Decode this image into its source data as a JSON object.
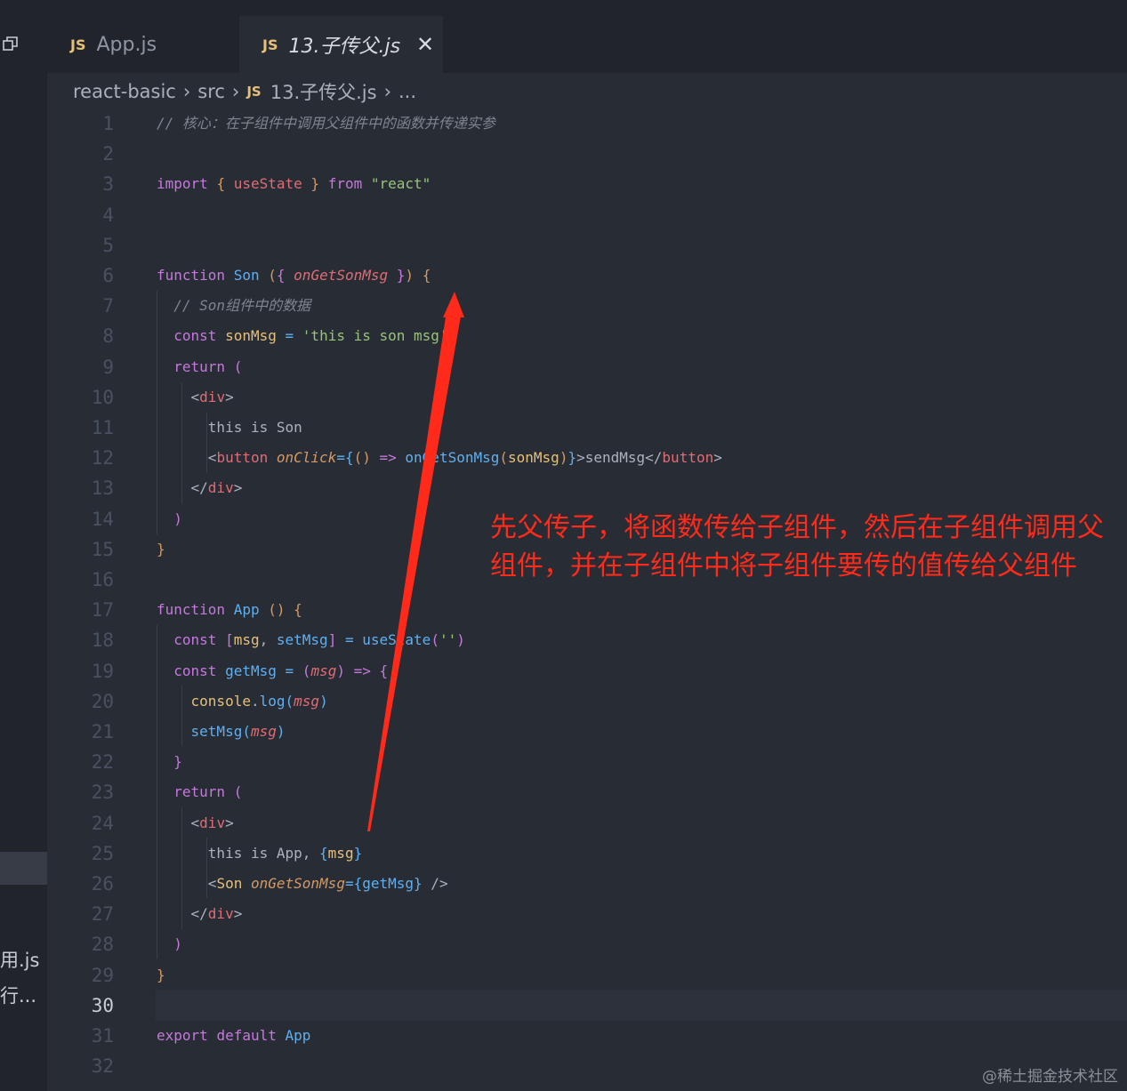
{
  "tabs": [
    {
      "icon": "JS",
      "label": "App.js",
      "active": false
    },
    {
      "icon": "JS",
      "label": "13.子传父.js",
      "active": true,
      "close": "✕"
    }
  ],
  "breadcrumb": [
    "react-basic",
    "src",
    "13.子传父.js",
    "..."
  ],
  "breadcrumb_file_icon": "JS",
  "sidebar_text": [
    "用.js",
    "行..."
  ],
  "code_lines": [
    {
      "n": "1",
      "tokens": [
        [
          "cm",
          "// 核心：在子组件中调用父组件中的函数并传递实参"
        ]
      ]
    },
    {
      "n": "2",
      "tokens": []
    },
    {
      "n": "3",
      "tokens": [
        [
          "kw",
          "import"
        ],
        [
          "pn",
          " "
        ],
        [
          "br1",
          "{"
        ],
        [
          "pn",
          " "
        ],
        [
          "tag",
          "useState"
        ],
        [
          "pn",
          " "
        ],
        [
          "br1",
          "}"
        ],
        [
          "pn",
          " "
        ],
        [
          "kw",
          "from"
        ],
        [
          "pn",
          " "
        ],
        [
          "str",
          "\"react\""
        ]
      ]
    },
    {
      "n": "4",
      "tokens": []
    },
    {
      "n": "5",
      "tokens": []
    },
    {
      "n": "6",
      "tokens": [
        [
          "kw",
          "function"
        ],
        [
          "pn",
          " "
        ],
        [
          "fn",
          "Son"
        ],
        [
          "pn",
          " "
        ],
        [
          "br1",
          "("
        ],
        [
          "br2",
          "{"
        ],
        [
          "pn",
          " "
        ],
        [
          "param",
          "onGetSonMsg"
        ],
        [
          "pn",
          " "
        ],
        [
          "br2",
          "}"
        ],
        [
          "br1",
          ")"
        ],
        [
          "pn",
          " "
        ],
        [
          "br1",
          "{"
        ]
      ]
    },
    {
      "n": "7",
      "tokens": [
        [
          "pn",
          "  "
        ],
        [
          "cm",
          "// Son组件中的数据"
        ]
      ]
    },
    {
      "n": "8",
      "tokens": [
        [
          "pn",
          "  "
        ],
        [
          "kw",
          "const"
        ],
        [
          "pn",
          " "
        ],
        [
          "var",
          "sonMsg"
        ],
        [
          "pn",
          " "
        ],
        [
          "fn",
          "="
        ],
        [
          "pn",
          " "
        ],
        [
          "str",
          "'this is son msg'"
        ]
      ]
    },
    {
      "n": "9",
      "tokens": [
        [
          "pn",
          "  "
        ],
        [
          "kw",
          "return"
        ],
        [
          "pn",
          " "
        ],
        [
          "br2",
          "("
        ]
      ]
    },
    {
      "n": "10",
      "tokens": [
        [
          "pn",
          "    "
        ],
        [
          "pn",
          "<"
        ],
        [
          "tag",
          "div"
        ],
        [
          "pn",
          ">"
        ]
      ]
    },
    {
      "n": "11",
      "tokens": [
        [
          "pn",
          "      "
        ],
        [
          "txt",
          "this is Son"
        ]
      ]
    },
    {
      "n": "12",
      "tokens": [
        [
          "pn",
          "      "
        ],
        [
          "pn",
          "<"
        ],
        [
          "tag",
          "button"
        ],
        [
          "pn",
          " "
        ],
        [
          "attr",
          "onClick"
        ],
        [
          "fn",
          "="
        ],
        [
          "br3",
          "{"
        ],
        [
          "br1",
          "()"
        ],
        [
          "pn",
          " "
        ],
        [
          "kw",
          "=>"
        ],
        [
          "pn",
          " "
        ],
        [
          "fn",
          "onGetSonMsg"
        ],
        [
          "br1",
          "("
        ],
        [
          "var",
          "sonMsg"
        ],
        [
          "br1",
          ")"
        ],
        [
          "br3",
          "}"
        ],
        [
          "pn",
          ">sendMsg</"
        ],
        [
          "tag",
          "button"
        ],
        [
          "pn",
          ">"
        ]
      ]
    },
    {
      "n": "13",
      "tokens": [
        [
          "pn",
          "    "
        ],
        [
          "pn",
          "</"
        ],
        [
          "tag",
          "div"
        ],
        [
          "pn",
          ">"
        ]
      ]
    },
    {
      "n": "14",
      "tokens": [
        [
          "pn",
          "  "
        ],
        [
          "br2",
          ")"
        ]
      ]
    },
    {
      "n": "15",
      "tokens": [
        [
          "br1",
          "}"
        ]
      ]
    },
    {
      "n": "16",
      "tokens": []
    },
    {
      "n": "17",
      "tokens": [
        [
          "kw",
          "function"
        ],
        [
          "pn",
          " "
        ],
        [
          "fn",
          "App"
        ],
        [
          "pn",
          " "
        ],
        [
          "br1",
          "()"
        ],
        [
          "pn",
          " "
        ],
        [
          "br1",
          "{"
        ]
      ]
    },
    {
      "n": "18",
      "tokens": [
        [
          "pn",
          "  "
        ],
        [
          "kw",
          "const"
        ],
        [
          "pn",
          " "
        ],
        [
          "br2",
          "["
        ],
        [
          "var",
          "msg"
        ],
        [
          "pn",
          ", "
        ],
        [
          "fn",
          "setMsg"
        ],
        [
          "br2",
          "]"
        ],
        [
          "pn",
          " "
        ],
        [
          "fn",
          "="
        ],
        [
          "pn",
          " "
        ],
        [
          "fn",
          "useState"
        ],
        [
          "br2",
          "("
        ],
        [
          "str",
          "''"
        ],
        [
          "br2",
          ")"
        ]
      ]
    },
    {
      "n": "19",
      "tokens": [
        [
          "pn",
          "  "
        ],
        [
          "kw",
          "const"
        ],
        [
          "pn",
          " "
        ],
        [
          "fn",
          "getMsg"
        ],
        [
          "pn",
          " "
        ],
        [
          "fn",
          "="
        ],
        [
          "pn",
          " "
        ],
        [
          "br2",
          "("
        ],
        [
          "param",
          "msg"
        ],
        [
          "br2",
          ")"
        ],
        [
          "pn",
          " "
        ],
        [
          "kw",
          "=>"
        ],
        [
          "pn",
          " "
        ],
        [
          "br2",
          "{"
        ]
      ]
    },
    {
      "n": "20",
      "tokens": [
        [
          "pn",
          "    "
        ],
        [
          "var",
          "console"
        ],
        [
          "pn",
          "."
        ],
        [
          "fn",
          "log"
        ],
        [
          "br3",
          "("
        ],
        [
          "param",
          "msg"
        ],
        [
          "br3",
          ")"
        ]
      ]
    },
    {
      "n": "21",
      "tokens": [
        [
          "pn",
          "    "
        ],
        [
          "fn",
          "setMsg"
        ],
        [
          "br3",
          "("
        ],
        [
          "param",
          "msg"
        ],
        [
          "br3",
          ")"
        ]
      ]
    },
    {
      "n": "22",
      "tokens": [
        [
          "pn",
          "  "
        ],
        [
          "br2",
          "}"
        ]
      ]
    },
    {
      "n": "23",
      "tokens": [
        [
          "pn",
          "  "
        ],
        [
          "kw",
          "return"
        ],
        [
          "pn",
          " "
        ],
        [
          "br2",
          "("
        ]
      ]
    },
    {
      "n": "24",
      "tokens": [
        [
          "pn",
          "    "
        ],
        [
          "pn",
          "<"
        ],
        [
          "tag",
          "div"
        ],
        [
          "pn",
          ">"
        ]
      ]
    },
    {
      "n": "25",
      "tokens": [
        [
          "pn",
          "      "
        ],
        [
          "txt",
          "this is App, "
        ],
        [
          "br3",
          "{"
        ],
        [
          "var",
          "msg"
        ],
        [
          "br3",
          "}"
        ]
      ]
    },
    {
      "n": "26",
      "tokens": [
        [
          "pn",
          "      "
        ],
        [
          "pn",
          "<"
        ],
        [
          "var",
          "Son"
        ],
        [
          "pn",
          " "
        ],
        [
          "attr",
          "onGetSonMsg"
        ],
        [
          "fn",
          "="
        ],
        [
          "br3",
          "{"
        ],
        [
          "fn",
          "getMsg"
        ],
        [
          "br3",
          "}"
        ],
        [
          "pn",
          " />"
        ]
      ]
    },
    {
      "n": "27",
      "tokens": [
        [
          "pn",
          "    "
        ],
        [
          "pn",
          "</"
        ],
        [
          "tag",
          "div"
        ],
        [
          "pn",
          ">"
        ]
      ]
    },
    {
      "n": "28",
      "tokens": [
        [
          "pn",
          "  "
        ],
        [
          "br2",
          ")"
        ]
      ]
    },
    {
      "n": "29",
      "tokens": [
        [
          "br1",
          "}"
        ]
      ]
    },
    {
      "n": "30",
      "tokens": [],
      "current": true
    },
    {
      "n": "31",
      "tokens": [
        [
          "kw",
          "export"
        ],
        [
          "pn",
          " "
        ],
        [
          "kw",
          "default"
        ],
        [
          "pn",
          " "
        ],
        [
          "fn",
          "App"
        ]
      ]
    },
    {
      "n": "32",
      "tokens": []
    }
  ],
  "annotation": "先父传子，将函数传给子组件，然后在子组件调用父组件，并在子组件中将子组件要传的值传给父组件",
  "annotation_color": "#ff2a1a",
  "watermark": "@稀土掘金技术社区"
}
